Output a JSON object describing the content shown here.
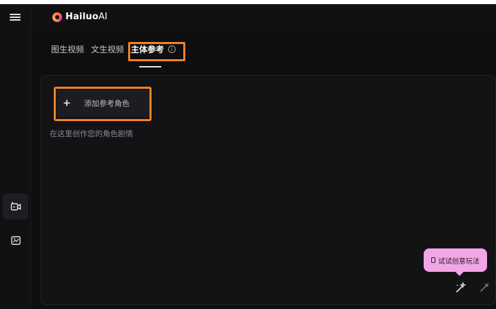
{
  "app": {
    "brand": "Hailuo",
    "brand_suffix": "AI"
  },
  "tabs": [
    {
      "label": "图生视频",
      "active": false
    },
    {
      "label": "文生视频",
      "active": false
    },
    {
      "label": "主体参考",
      "active": true,
      "info_icon": "info-icon"
    }
  ],
  "sidebar": {
    "items": [
      {
        "icon": "video-generate-icon",
        "active": true
      },
      {
        "icon": "image-to-video-icon",
        "active": false
      }
    ]
  },
  "editor": {
    "add_reference_plus": "+",
    "add_reference_label": "添加参考角色",
    "prompt_placeholder": "在这里创作您的角色剧情"
  },
  "tooltip": {
    "label": "试试创意玩法"
  },
  "colors": {
    "highlight": "#f58220",
    "background": "#0e0e10",
    "bubble": "#f3a6e6"
  }
}
